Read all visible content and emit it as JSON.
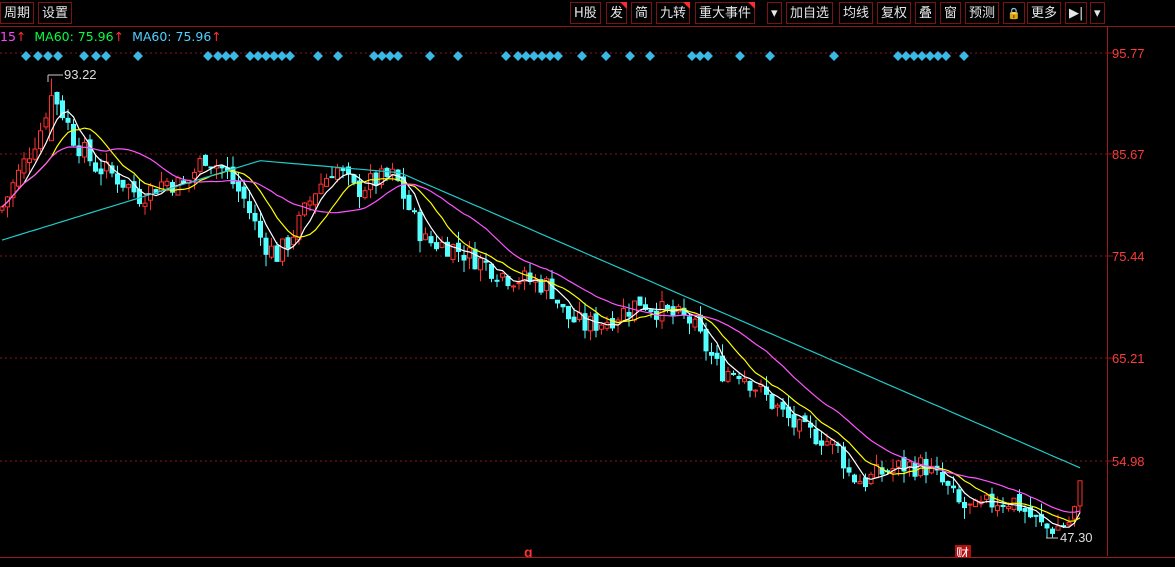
{
  "toolbar": {
    "left_buttons": [
      "周期",
      "设置"
    ],
    "right_buttons": [
      "H股",
      "发",
      "简",
      "九转",
      "重大事件",
      "▾",
      "加自选",
      "均线",
      "复权",
      "叠",
      "窗",
      "预测",
      "🔒",
      "更多",
      "▶|",
      "▾"
    ]
  },
  "legend": {
    "ma_prev_suffix": "15",
    "ma_a_label": "MA60: 75.96",
    "ma_b_label": "MA60: 75.96",
    "arrow": "↑",
    "colors": {
      "prev": "#ff44ff",
      "ma_a": "#00ff40",
      "ma_b": "#4fd0ff",
      "arrow": "#ff3030"
    }
  },
  "price_axis": {
    "labels": [
      "95.77",
      "85.67",
      "75.44",
      "65.21",
      "54.98"
    ],
    "label_color": "#ff3b3b"
  },
  "annotations": {
    "high": "93.22",
    "low": "47.30",
    "marker_q": "q",
    "marker_cai": "财"
  },
  "colors": {
    "up": "#ff3030",
    "down": "#54ffff",
    "ma5": "#ffffff",
    "ma10": "#ffff00",
    "ma20": "#ff55ff",
    "ma60": "#22c9c9",
    "grid": "#8a1515",
    "diamond": "#3ab8e6"
  },
  "icons": {
    "lock": "lock-icon",
    "dropdown": "chevron-down-icon",
    "end": "skip-end-icon"
  }
}
